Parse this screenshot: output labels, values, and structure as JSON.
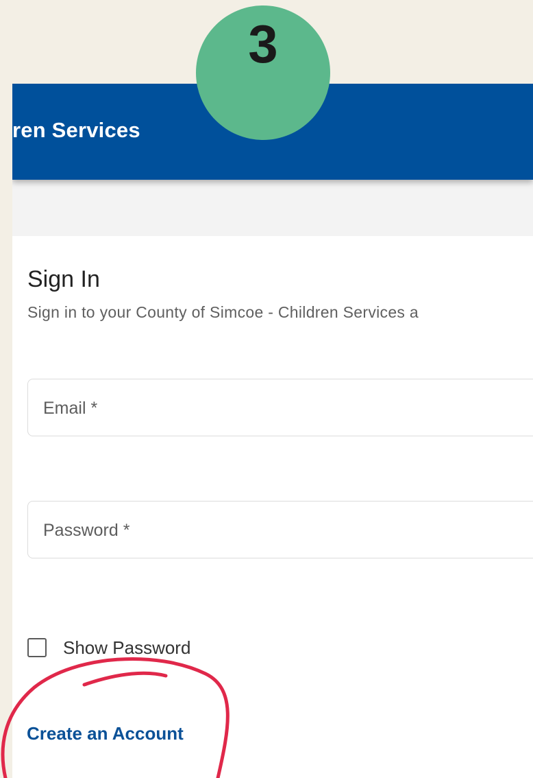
{
  "header": {
    "title": "ren Services"
  },
  "step_badge": {
    "number": "3",
    "color": "#5cb88c"
  },
  "signin": {
    "title": "Sign In",
    "subtitle": "Sign in to your County of Simcoe - Children Services a",
    "email_label": "Email *",
    "password_label": "Password *",
    "show_password_label": "Show Password",
    "show_password_checked": false,
    "create_account_link": "Create an Account"
  },
  "colors": {
    "header_bg": "#00509b",
    "page_bg": "#f3efe5",
    "link": "#0b5197",
    "annotation_stroke": "#e0284a"
  }
}
